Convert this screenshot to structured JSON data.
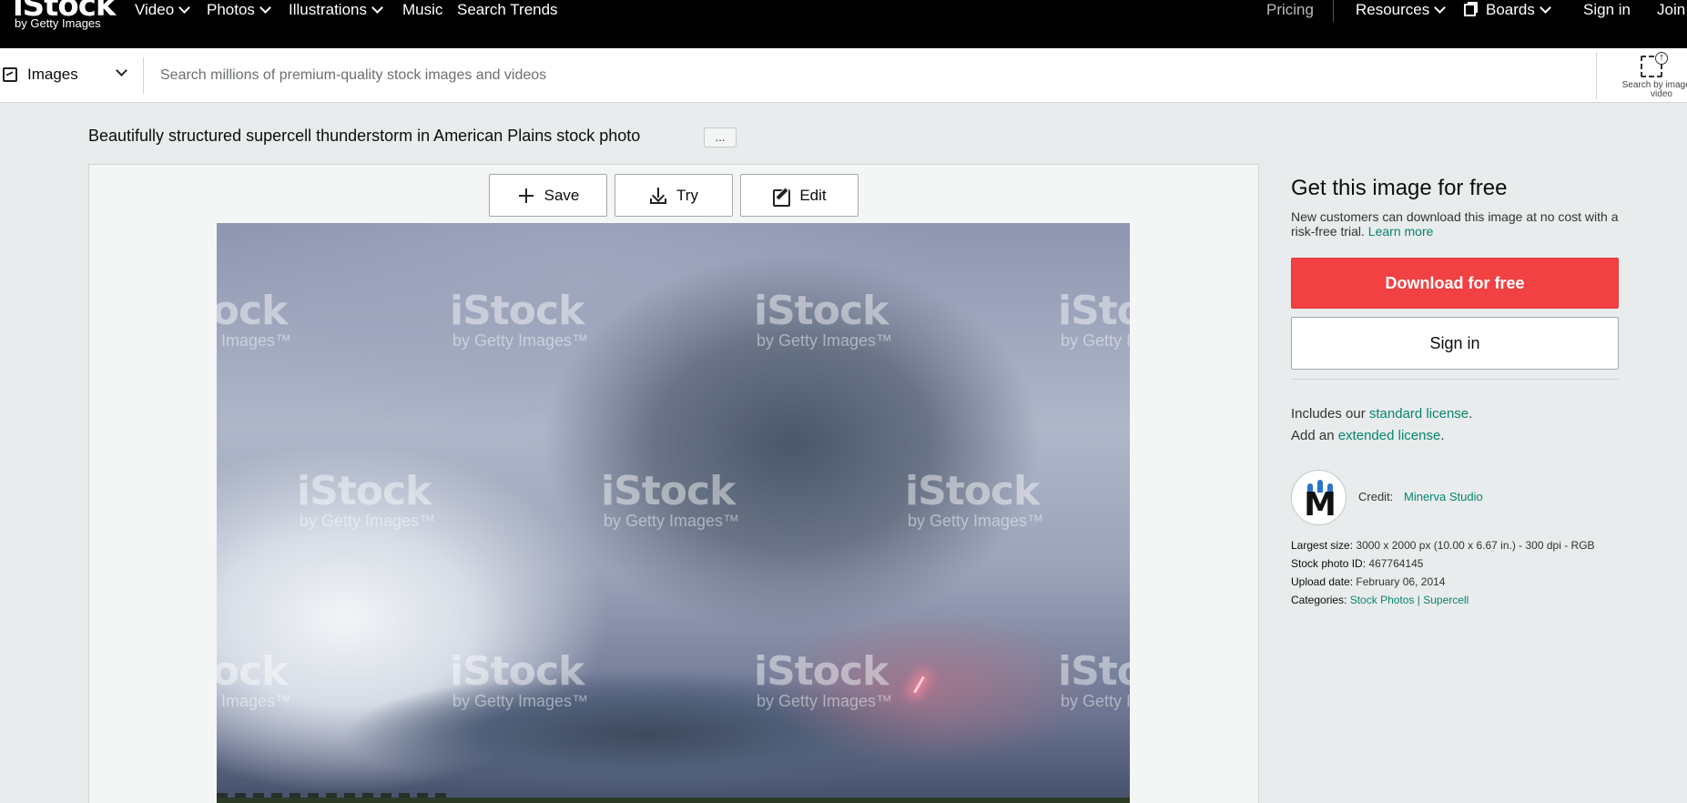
{
  "nav": {
    "logo_text": "iStock",
    "logo_sub": "by Getty Images",
    "left_items": [
      "Video",
      "Photos",
      "Illustrations",
      "Music",
      "Search Trends"
    ],
    "right_items": {
      "pricing": "Pricing",
      "resources": "Resources",
      "boards": "Boards",
      "sign_in": "Sign in",
      "join": "Join"
    }
  },
  "search": {
    "media_type": "Images",
    "placeholder": "Search millions of premium-quality stock images and videos",
    "value": "",
    "visual_search_label": "Search by image or video"
  },
  "asset": {
    "title": "Beautifully structured supercell thunderstorm in American Plains stock photo",
    "more_label": "...",
    "actions": {
      "save": "Save",
      "try": "Try",
      "edit": "Edit"
    },
    "watermark_big": "iStock",
    "watermark_small": "by Getty Images™"
  },
  "sidebar": {
    "heading": "Get this image for free",
    "desc_text": "New customers can download this image at no cost with a risk-free trial.",
    "learn_more": "Learn more",
    "download_button": "Download for free",
    "signin_button": "Sign in",
    "license_prefix": "Includes our",
    "license_link": "standard license",
    "license_suffix": ".",
    "extended_prefix": "Add an",
    "extended_link": "extended license",
    "extended_suffix": ".",
    "credit_label": "Credit:",
    "credit_name": "Minerva Studio",
    "largest_size_label": "Largest size:",
    "largest_size_value": "3000 x 2000 px (10.00 x 6.67 in.) - 300 dpi - RGB",
    "stock_id_label": "Stock photo ID:",
    "stock_id_value": "467764145",
    "upload_date_label": "Upload date:",
    "upload_date_value": "February 06, 2014",
    "categories_label": "Categories:",
    "category_1": "Stock Photos",
    "category_sep": "|",
    "category_2": "Supercell"
  },
  "colors": {
    "accent_red": "#f24143",
    "link_green": "#08856f",
    "nav_bg": "#000000"
  }
}
